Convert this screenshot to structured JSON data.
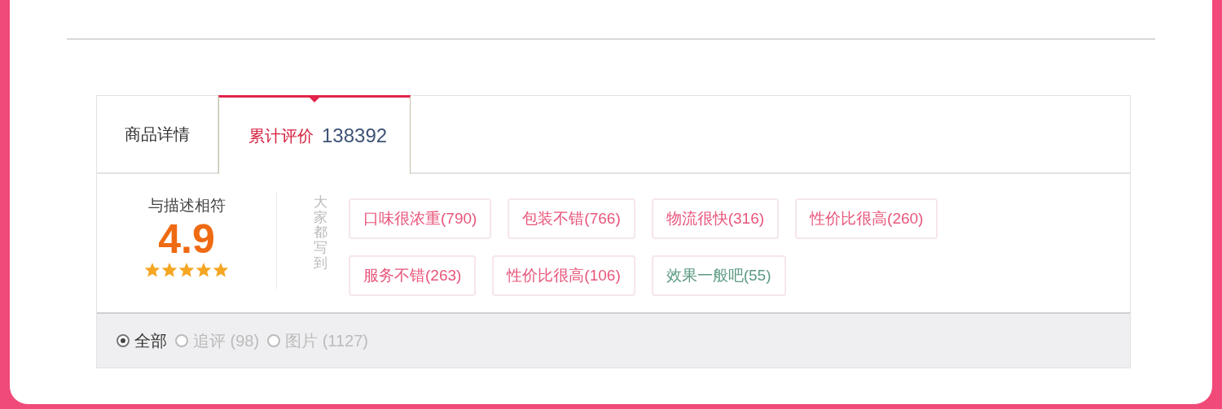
{
  "tabs": [
    {
      "label": "商品详情",
      "selected": false
    },
    {
      "label": "累计评价",
      "count": "138392",
      "selected": true
    }
  ],
  "rating": {
    "label": "与描述相符",
    "score": "4.9",
    "stars": 5
  },
  "impressions": {
    "label": "大家都写到",
    "tags": [
      {
        "text": "口味很浓重(790)",
        "color": "#e8557a"
      },
      {
        "text": "包装不错(766)",
        "color": "#e8557a"
      },
      {
        "text": "物流很快(316)",
        "color": "#e8557a"
      },
      {
        "text": "性价比很高(260)",
        "color": "#e8557a"
      },
      {
        "text": "服务不错(263)",
        "color": "#e8557a"
      },
      {
        "text": "性价比很高(106)",
        "color": "#e8557a"
      },
      {
        "text": "效果一般吧(55)",
        "color": "#5c9a82"
      }
    ]
  },
  "filters": [
    {
      "label": "全部",
      "selected": true
    },
    {
      "label": "追评 (98)",
      "selected": false
    },
    {
      "label": "图片 (1127)",
      "selected": false
    }
  ]
}
